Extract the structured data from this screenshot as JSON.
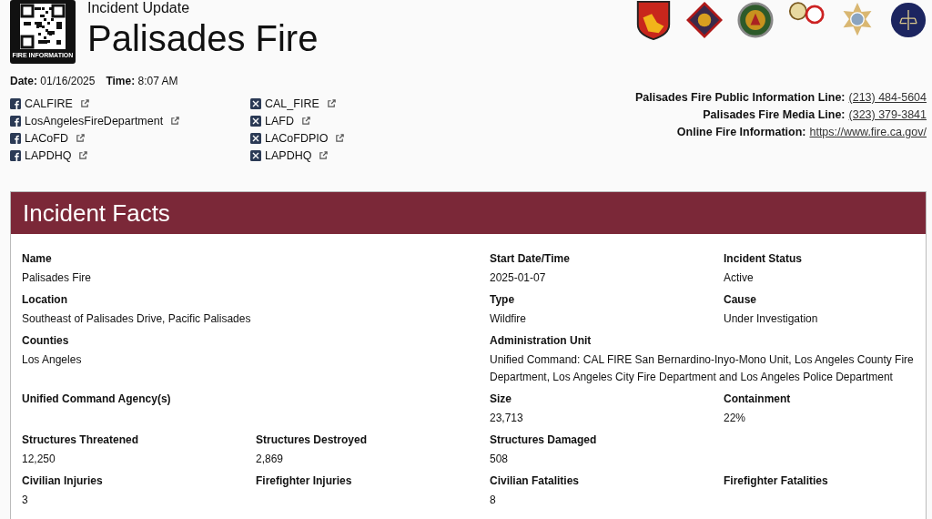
{
  "header": {
    "qr_caption": "FIRE INFORMATION",
    "subtitle": "Incident Update",
    "title": "Palisades Fire",
    "date_label": "Date:",
    "date": "01/16/2025",
    "time_label": "Time:",
    "time": "8:07 AM"
  },
  "social": {
    "facebook": [
      "CALFIRE",
      "LosAngelesFireDepartment",
      "LACoFD",
      "LAPDHQ"
    ],
    "x": [
      "CAL_FIRE",
      "LAFD",
      "LACoFDPIO",
      "LAPDHQ"
    ]
  },
  "contacts": [
    {
      "label": "Palisades Fire Public Information Line:",
      "value": "(213) 484-5604"
    },
    {
      "label": "Palisades Fire Media Line:",
      "value": "(323) 379-3841"
    },
    {
      "label": "Online Fire Information:",
      "value": "https://www.fire.ca.gov/"
    }
  ],
  "facts": {
    "title": "Incident Facts",
    "fields": [
      {
        "label": "Name",
        "value": "Palisades Fire"
      },
      {
        "label": "Start Date/Time",
        "value": "2025-01-07"
      },
      {
        "label": "Incident Status",
        "value": "Active"
      },
      {
        "label": "Location",
        "value": "Southeast of Palisades Drive, Pacific Palisades"
      },
      {
        "label": "Type",
        "value": "Wildfire"
      },
      {
        "label": "Cause",
        "value": "Under Investigation"
      },
      {
        "label": "Counties",
        "value": "Los Angeles"
      },
      {
        "label": "Administration Unit",
        "value": "Unified Command: CAL FIRE San Bernardino-Inyo-Mono Unit, Los Angeles County Fire Department, Los Angeles City Fire Department and Los Angeles Police Department"
      },
      {
        "label": "Unified Command Agency(s)"
      },
      {
        "label": "Size",
        "value": "23,713"
      },
      {
        "label": "Containment",
        "value": "22%"
      },
      {
        "label": "Structures Threatened",
        "value": "12,250"
      },
      {
        "label": "Structures Destroyed",
        "value": "2,869"
      },
      {
        "label": "Structures Damaged",
        "value": "508"
      },
      {
        "label": "Civilian Injuries",
        "value": "3"
      },
      {
        "label": "Firefighter Injuries"
      },
      {
        "label": "Civilian Fatalities",
        "value": "8"
      },
      {
        "label": "Firefighter Fatalities"
      }
    ]
  }
}
